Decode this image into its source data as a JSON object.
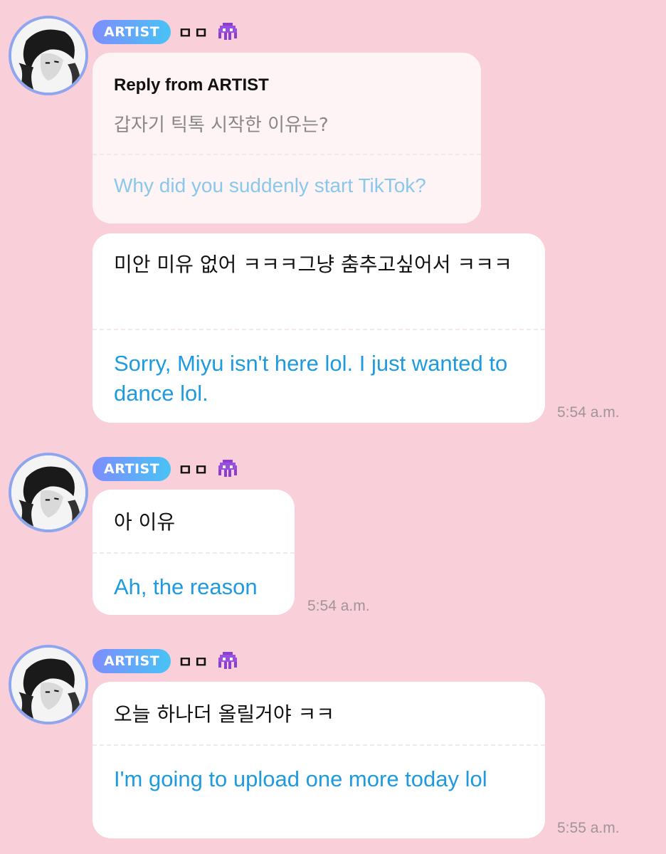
{
  "messages": [
    {
      "badge": "ARTIST",
      "name": "ㅁㅁ",
      "reply": {
        "title": "Reply from ARTIST",
        "original": "갑자기 틱톡 시작한 이유는?",
        "translation": "Why did you suddenly start TikTok?"
      },
      "original": "미안 미유 없어 ㅋㅋㅋ그냥 춤추고싶어서 ㅋㅋㅋ",
      "translation": "Sorry, Miyu isn't here lol. I just wanted to dance lol.",
      "time": "5:54 a.m."
    },
    {
      "badge": "ARTIST",
      "name": "ㅁㅁ",
      "original": "아 이유",
      "translation": "Ah, the reason",
      "time": "5:54 a.m."
    },
    {
      "badge": "ARTIST",
      "name": "ㅁㅁ",
      "original": "오늘 하나더 올릴거야 ㅋㅋ",
      "translation": "I'm going to upload one more today lol",
      "time": "5:55 a.m."
    }
  ],
  "colors": {
    "background": "#f9d0d9",
    "translation": "#1e9be0",
    "badge_start": "#7e8dff",
    "badge_end": "#48c3f5"
  },
  "icons": [
    "artist-avatar",
    "purple-alien-emoji-icon"
  ]
}
